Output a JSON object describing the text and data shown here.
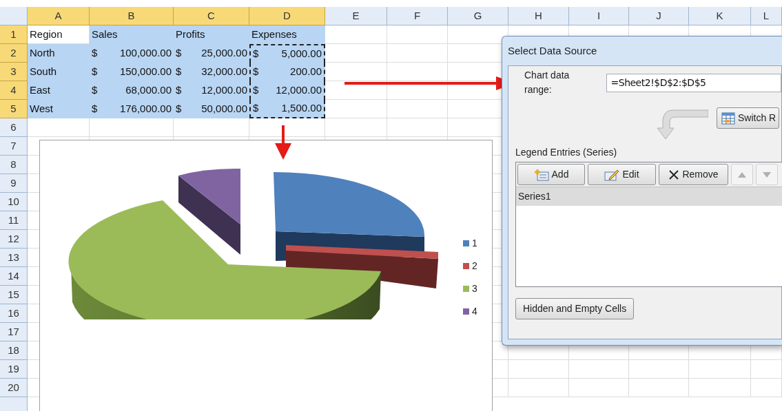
{
  "sheet": {
    "columns": [
      {
        "label": "A",
        "selected": true
      },
      {
        "label": "B",
        "selected": true
      },
      {
        "label": "C",
        "selected": true
      },
      {
        "label": "D",
        "selected": true
      },
      {
        "label": "E",
        "selected": false
      },
      {
        "label": "F",
        "selected": false
      },
      {
        "label": "G",
        "selected": false
      },
      {
        "label": "H",
        "selected": false
      },
      {
        "label": "I",
        "selected": false
      },
      {
        "label": "J",
        "selected": false
      },
      {
        "label": "K",
        "selected": false
      },
      {
        "label": "L",
        "selected": false
      }
    ],
    "rows": [
      {
        "number": "1",
        "selected": true,
        "cells": [
          {
            "kind": "text",
            "text": "Region",
            "selected": false,
            "marked": false
          },
          {
            "kind": "text",
            "text": "Sales",
            "selected": true,
            "marked": false
          },
          {
            "kind": "text",
            "text": "Profits",
            "selected": true,
            "marked": false
          },
          {
            "kind": "text",
            "text": "Expenses",
            "selected": true,
            "marked": false
          }
        ]
      },
      {
        "number": "2",
        "selected": true,
        "cells": [
          {
            "kind": "text",
            "text": "North",
            "selected": true,
            "marked": false
          },
          {
            "kind": "accounting",
            "symbol": "$",
            "amount": "100,000.00",
            "selected": true,
            "marked": false
          },
          {
            "kind": "accounting",
            "symbol": "$",
            "amount": "25,000.00",
            "selected": true,
            "marked": false
          },
          {
            "kind": "accounting",
            "symbol": "$",
            "amount": "5,000.00",
            "selected": true,
            "marked": true
          }
        ]
      },
      {
        "number": "3",
        "selected": true,
        "cells": [
          {
            "kind": "text",
            "text": "South",
            "selected": true,
            "marked": false
          },
          {
            "kind": "accounting",
            "symbol": "$",
            "amount": "150,000.00",
            "selected": true,
            "marked": false
          },
          {
            "kind": "accounting",
            "symbol": "$",
            "amount": "32,000.00",
            "selected": true,
            "marked": false
          },
          {
            "kind": "accounting",
            "symbol": "$",
            "amount": "200.00",
            "selected": true,
            "marked": true
          }
        ]
      },
      {
        "number": "4",
        "selected": true,
        "cells": [
          {
            "kind": "text",
            "text": "East",
            "selected": true,
            "marked": false
          },
          {
            "kind": "accounting",
            "symbol": "$",
            "amount": "68,000.00",
            "selected": true,
            "marked": false
          },
          {
            "kind": "accounting",
            "symbol": "$",
            "amount": "12,000.00",
            "selected": true,
            "marked": false
          },
          {
            "kind": "accounting",
            "symbol": "$",
            "amount": "12,000.00",
            "selected": true,
            "marked": true
          }
        ]
      },
      {
        "number": "5",
        "selected": true,
        "cells": [
          {
            "kind": "text",
            "text": "West",
            "selected": true,
            "marked": false
          },
          {
            "kind": "accounting",
            "symbol": "$",
            "amount": "176,000.00",
            "selected": true,
            "marked": false
          },
          {
            "kind": "accounting",
            "symbol": "$",
            "amount": "50,000.00",
            "selected": true,
            "marked": false
          },
          {
            "kind": "accounting",
            "symbol": "$",
            "amount": "1,500.00",
            "selected": true,
            "marked": true
          }
        ]
      },
      {
        "number": "6",
        "selected": false,
        "cells": []
      },
      {
        "number": "7",
        "selected": false,
        "cells": []
      },
      {
        "number": "8",
        "selected": false,
        "cells": []
      },
      {
        "number": "9",
        "selected": false,
        "cells": []
      },
      {
        "number": "10",
        "selected": false,
        "cells": []
      },
      {
        "number": "11",
        "selected": false,
        "cells": []
      },
      {
        "number": "12",
        "selected": false,
        "cells": []
      },
      {
        "number": "13",
        "selected": false,
        "cells": []
      },
      {
        "number": "14",
        "selected": false,
        "cells": []
      },
      {
        "number": "15",
        "selected": false,
        "cells": []
      },
      {
        "number": "16",
        "selected": false,
        "cells": []
      },
      {
        "number": "17",
        "selected": false,
        "cells": []
      },
      {
        "number": "18",
        "selected": false,
        "cells": []
      },
      {
        "number": "19",
        "selected": false,
        "cells": []
      },
      {
        "number": "20",
        "selected": false,
        "cells": []
      }
    ]
  },
  "chart": {
    "legend": [
      {
        "label": "1",
        "color": "#4f81bd"
      },
      {
        "label": "2",
        "color": "#c0504d"
      },
      {
        "label": "3",
        "color": "#9bbb59"
      },
      {
        "label": "4",
        "color": "#8064a2"
      }
    ]
  },
  "dialog": {
    "title": "Select Data Source",
    "range_label": "Chart data range:",
    "range_value": "=Sheet2!$D$2:$D$5",
    "switch_button": "Switch R",
    "legend_heading": "Legend Entries (Series)",
    "toolbar": [
      {
        "kind": "add",
        "label": "Add",
        "disabled": false
      },
      {
        "kind": "edit",
        "label": "Edit",
        "disabled": false
      },
      {
        "kind": "remove",
        "label": "Remove",
        "disabled": false
      },
      {
        "kind": "up",
        "disabled": true
      },
      {
        "kind": "down",
        "disabled": true
      }
    ],
    "series": [
      {
        "label": "Series1",
        "selected": true
      }
    ],
    "hidden_button": "Hidden and Empty Cells"
  }
}
